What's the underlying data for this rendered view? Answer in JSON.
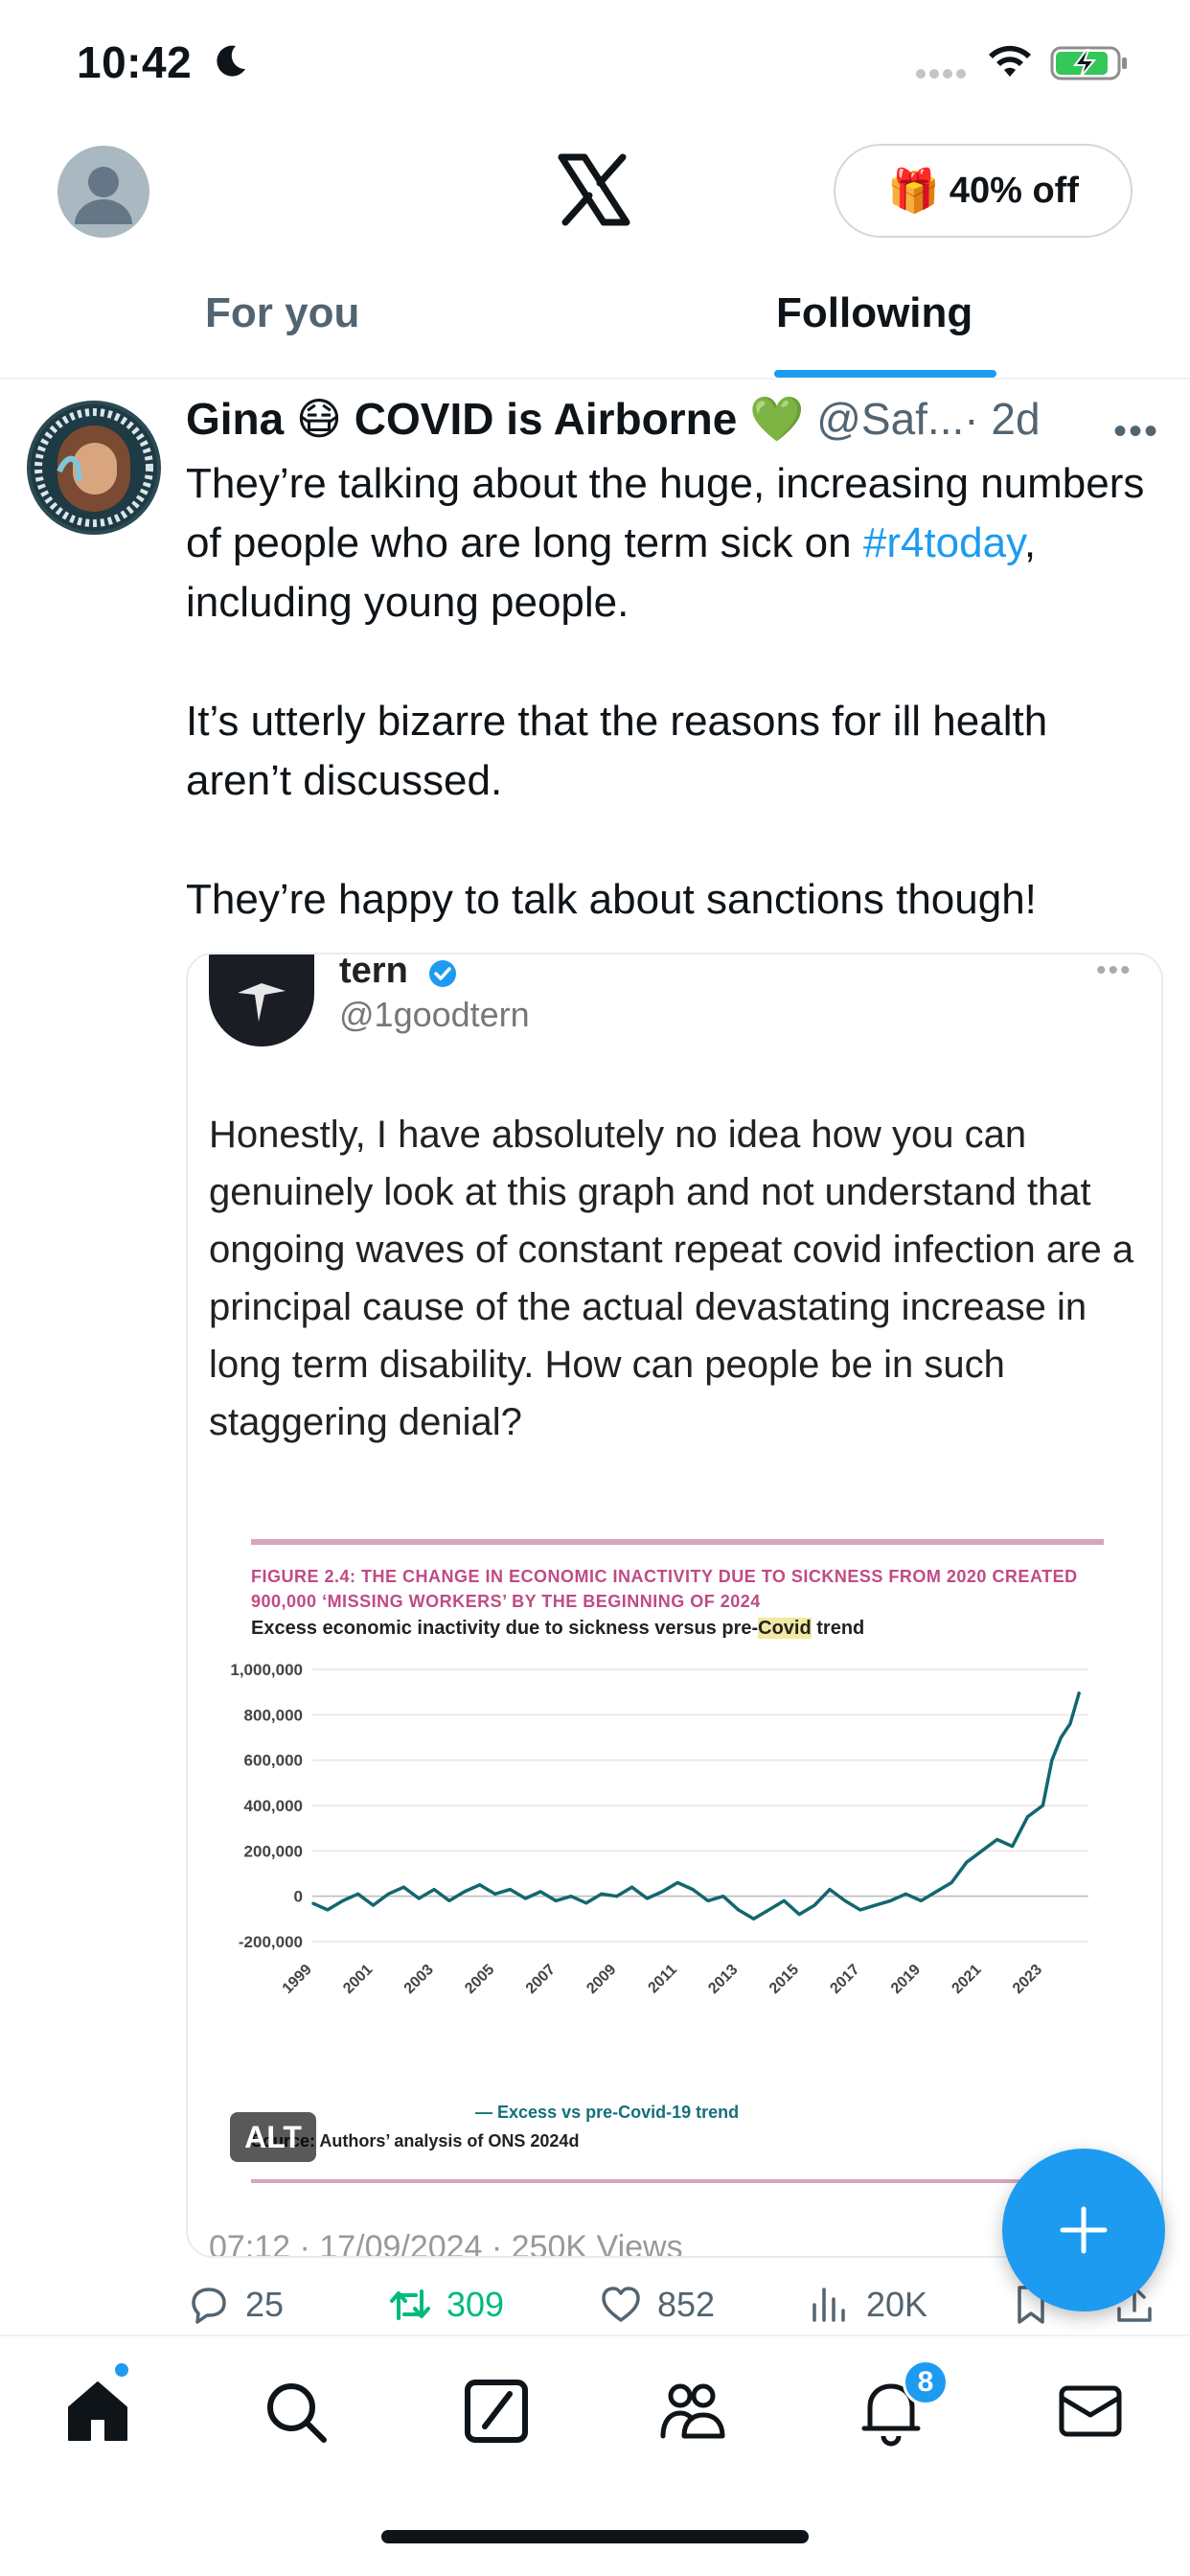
{
  "status_bar": {
    "time": "10:42"
  },
  "header": {
    "promo_label": "40% off",
    "tabs": [
      {
        "label": "For you",
        "active": false
      },
      {
        "label": "Following",
        "active": true
      }
    ]
  },
  "tweet": {
    "display_name": "Gina 😷 COVID is Airborne 💚",
    "handle": "@Saf...",
    "time": "· 2d",
    "text": {
      "p1_before": "They’re talking about the huge, increasing numbers of people who are long term sick  on ",
      "hashtag": "#r4today",
      "p1_after": ", including young people.",
      "p2": "It’s utterly bizarre that the reasons for ill health aren’t discussed.",
      "p3": "They’re happy to talk about sanctions though!"
    },
    "quoted": {
      "name": "tern",
      "handle": "@1goodtern",
      "text": "Honestly, I have absolutely no idea how you can genuinely look at this graph and not understand that ongoing waves of constant repeat covid infection are a principal cause of the actual devastating increase in long term disability. How can people be in such staggering denial?",
      "footer": "07:12 · 17/09/2024 · 250K Views"
    },
    "alt_label": "ALT",
    "stats": {
      "replies": "25",
      "reposts": "309",
      "likes": "852",
      "views": "20K"
    }
  },
  "chart_data": {
    "type": "line",
    "title": "FIGURE 2.4: THE CHANGE IN ECONOMIC INACTIVITY DUE TO SICKNESS FROM 2020 CREATED 900,000 ‘MISSING WORKERS’ BY THE BEGINNING OF 2024",
    "subtitle_before": "Excess economic inactivity due to sickness versus pre-",
    "subtitle_highlight": "Covid",
    "subtitle_after": " trend",
    "xlabel": "",
    "ylabel": "",
    "ylim": [
      -200000,
      1000000
    ],
    "xlim": [
      1999,
      2024.5
    ],
    "y_ticks": [
      "1,000,000",
      "800,000",
      "600,000",
      "400,000",
      "200,000",
      "0",
      "-200,000"
    ],
    "x_ticks": [
      "1999",
      "2001",
      "2003",
      "2005",
      "2007",
      "2009",
      "2011",
      "2013",
      "2015",
      "2017",
      "2019",
      "2021",
      "2023"
    ],
    "series": [
      {
        "name": "Excess vs pre-Covid-19 trend",
        "color": "#13676f",
        "x": [
          1999,
          1999.5,
          2000,
          2000.5,
          2001,
          2001.5,
          2002,
          2002.5,
          2003,
          2003.5,
          2004,
          2004.5,
          2005,
          2005.5,
          2006,
          2006.5,
          2007,
          2007.5,
          2008,
          2008.5,
          2009,
          2009.5,
          2010,
          2010.5,
          2011,
          2011.5,
          2012,
          2012.5,
          2013,
          2013.5,
          2014,
          2014.5,
          2015,
          2015.5,
          2016,
          2016.5,
          2017,
          2017.5,
          2018,
          2018.5,
          2019,
          2019.5,
          2020,
          2020.5,
          2021,
          2021.5,
          2022,
          2022.5,
          2023,
          2023.3,
          2023.6,
          2023.9,
          2024.2
        ],
        "values": [
          -30000,
          -60000,
          -20000,
          10000,
          -40000,
          10000,
          40000,
          -10000,
          30000,
          -20000,
          20000,
          50000,
          10000,
          30000,
          -10000,
          20000,
          -20000,
          0,
          -30000,
          10000,
          0,
          40000,
          -10000,
          20000,
          60000,
          30000,
          -20000,
          0,
          -60000,
          -100000,
          -60000,
          -20000,
          -80000,
          -40000,
          30000,
          -20000,
          -60000,
          -40000,
          -20000,
          10000,
          -20000,
          20000,
          60000,
          150000,
          200000,
          250000,
          220000,
          350000,
          400000,
          600000,
          700000,
          760000,
          900000
        ]
      }
    ],
    "source": "Source: Authors’ analysis of ONS 2024d",
    "legend_position": "bottom"
  }
}
